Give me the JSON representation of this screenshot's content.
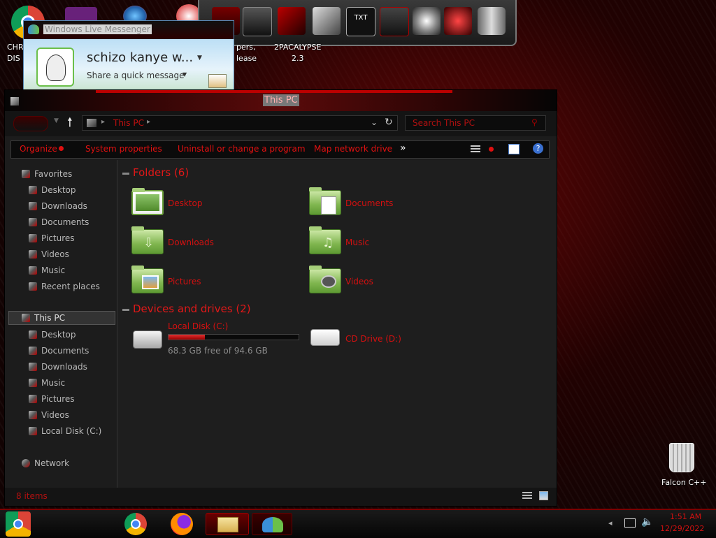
{
  "desktop": {
    "icons": [
      {
        "label": "CHR\nDIS",
        "icon": "chrome-icon"
      },
      {
        "label": "pers,\nlease",
        "icon": "wallpapers-icon"
      },
      {
        "label": "2PACALYPSE\n2.3",
        "icon": "2pacalypse-icon"
      },
      {
        "label": "Falcon C++",
        "icon": "recycle-bin-icon"
      }
    ]
  },
  "messenger": {
    "title": "Windows Live Messenger",
    "name": "schizo kanye w...",
    "status_prompt": "Share a quick message"
  },
  "explorer": {
    "title": "This PC",
    "address": "This PC",
    "search_placeholder": "Search This PC",
    "toolbar": [
      "Organize",
      "System properties",
      "Uninstall or change a program",
      "Map network drive",
      "»"
    ],
    "favorites": {
      "heading": "Favorites",
      "items": [
        "Desktop",
        "Downloads",
        "Documents",
        "Pictures",
        "Videos",
        "Music",
        "Recent places"
      ]
    },
    "thispc": {
      "heading": "This PC",
      "items": [
        "Desktop",
        "Documents",
        "Downloads",
        "Music",
        "Pictures",
        "Videos",
        "Local Disk (C:)"
      ]
    },
    "network": "Network",
    "folders_header": "Folders (6)",
    "folders": [
      "Desktop",
      "Documents",
      "Downloads",
      "Music",
      "Pictures",
      "Videos"
    ],
    "devices_header": "Devices and drives (2)",
    "drive_c": {
      "name": "Local Disk (C:)",
      "free": "68.3 GB free of 94.6 GB",
      "used_fraction": 0.28
    },
    "drive_d": {
      "name": "CD Drive (D:)"
    },
    "status": "8 items"
  },
  "taskbar": {
    "time": "1:51 AM",
    "date": "12/29/2022"
  },
  "colors": {
    "accent": "#e01010",
    "text_gray": "#b8b8b8"
  }
}
